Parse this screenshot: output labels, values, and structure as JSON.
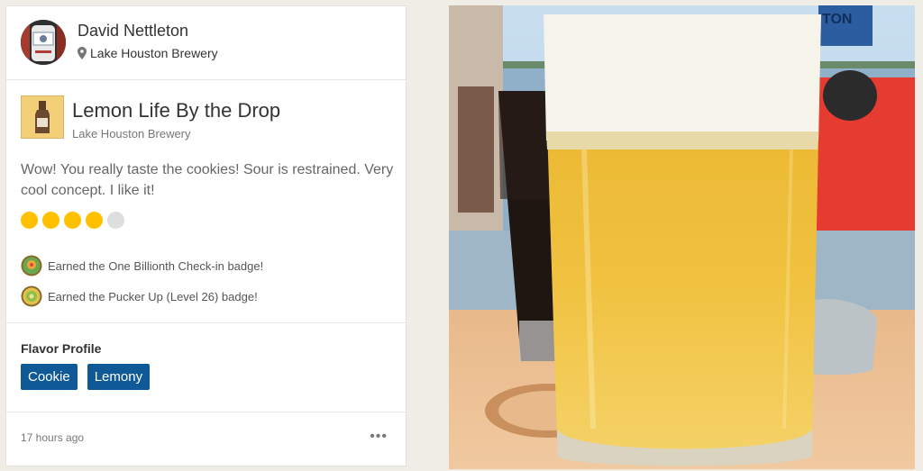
{
  "user": {
    "name": "David Nettleton",
    "location": "Lake Houston Brewery",
    "location_icon": "map-pin-icon"
  },
  "checkin": {
    "beer_name": "Lemon Life By the Drop",
    "brewery": "Lake Houston Brewery",
    "comment": "Wow! You really taste the cookies! Sour is restrained. Very cool concept. I like it!",
    "rating": {
      "filled": 4,
      "total": 5,
      "color_on": "#ffc000",
      "color_off": "#dedede"
    },
    "badges": [
      {
        "label": "Earned the One Billionth Check-in badge!",
        "icon": "billionth-checkin-badge-icon"
      },
      {
        "label": "Earned the Pucker Up (Level 26) badge!",
        "icon": "pucker-up-badge-icon"
      }
    ]
  },
  "flavor_profile": {
    "title": "Flavor Profile",
    "tags": [
      "Cookie",
      "Lemony"
    ],
    "tag_color": "#0f5a96"
  },
  "footer": {
    "time": "17 hours ago",
    "more_icon": "more-options-icon"
  },
  "photo": {
    "subject": "beer-glass-photo",
    "sign_text": "TON"
  }
}
